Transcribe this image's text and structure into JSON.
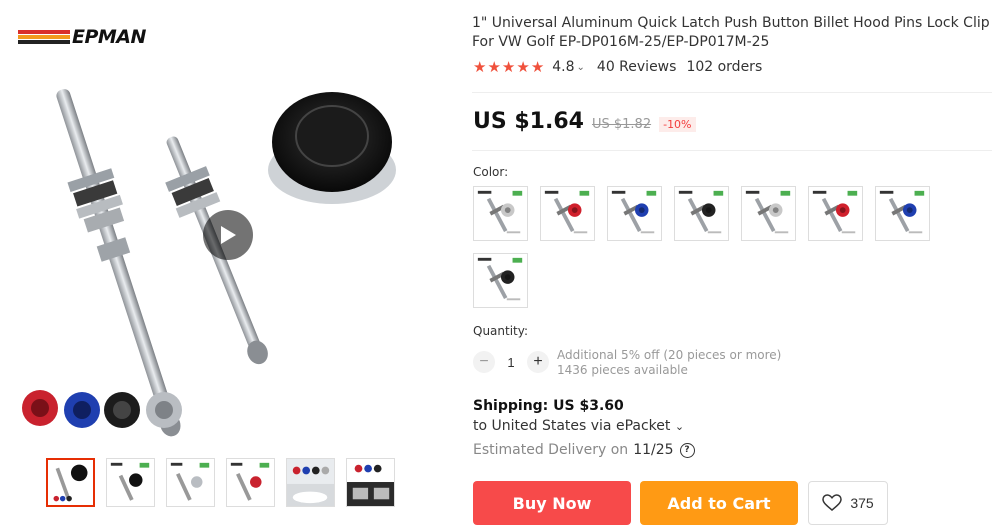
{
  "brand": {
    "name": "EPMAN",
    "stripe_colors": [
      "#d9302c",
      "#f29a1f",
      "#222222"
    ]
  },
  "gallery": {
    "play_icon": "play-icon",
    "thumbnails": [
      {
        "name": "thumb-1",
        "active": true
      },
      {
        "name": "thumb-2",
        "active": false
      },
      {
        "name": "thumb-3",
        "active": false
      },
      {
        "name": "thumb-4",
        "active": false
      },
      {
        "name": "thumb-5",
        "active": false
      },
      {
        "name": "thumb-6",
        "active": false
      }
    ]
  },
  "product": {
    "title": "1\" Universal Aluminum Quick Latch Push Button Billet Hood Pins Lock Clip For VW Golf EP-DP016M-25/EP-DP017M-25",
    "rating": "4.8",
    "stars": 5,
    "reviews": "40 Reviews",
    "orders": "102 orders",
    "price": "US $1.64",
    "old_price": "US $1.82",
    "discount": "-10%"
  },
  "color": {
    "label": "Color:",
    "options": [
      "silver",
      "red",
      "blue",
      "black",
      "silver",
      "red",
      "blue",
      "black"
    ],
    "swatch_colors": {
      "silver": "#c8c8c8",
      "red": "#d0202c",
      "blue": "#1f3fb0",
      "black": "#222222"
    }
  },
  "quantity": {
    "label": "Quantity:",
    "value": "1",
    "minus": "−",
    "plus": "+",
    "discount_note": "Additional 5% off (20 pieces or more)",
    "available": "1436 pieces available"
  },
  "shipping": {
    "title": "Shipping: US $3.60",
    "to": "to United States via ePacket",
    "delivery_label": "Estimated Delivery on",
    "delivery_date": "11/25",
    "help_icon": "question-circle-icon"
  },
  "actions": {
    "buy_now": "Buy Now",
    "add_to_cart": "Add to Cart",
    "wishlist_count": "375",
    "colors": {
      "buy": "#f74a4a",
      "cart": "#ff9a14"
    }
  }
}
